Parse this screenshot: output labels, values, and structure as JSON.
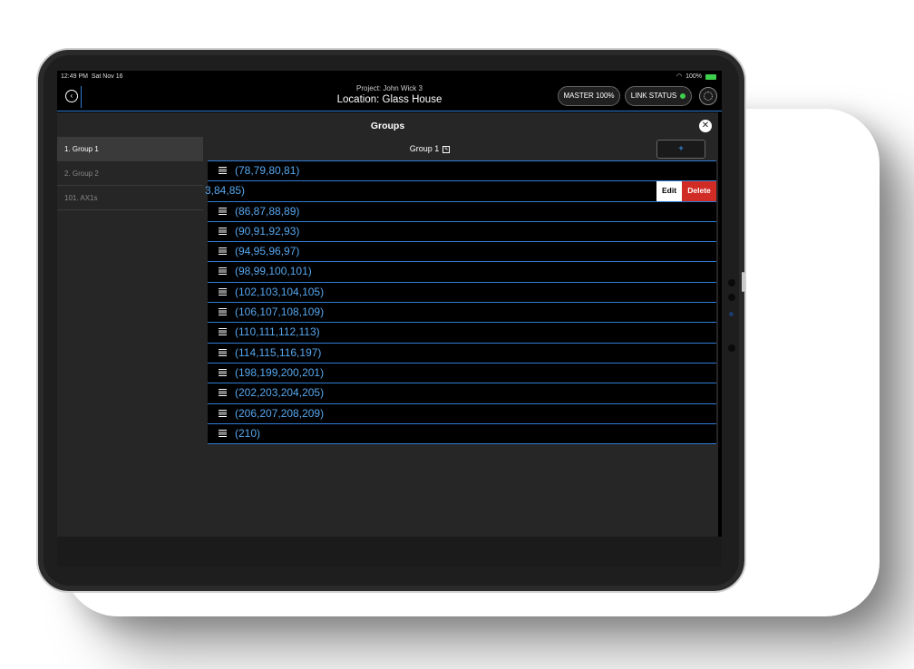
{
  "status_bar": {
    "time": "12:49 PM",
    "date": "Sat Nov 16",
    "battery": "100%"
  },
  "header": {
    "project": "Project: John Wick 3",
    "location": "Location: Glass House",
    "master_label": "MASTER 100%",
    "link_label": "LINK STATUS",
    "link_color": "#3ecf4e"
  },
  "panel": {
    "title": "Groups",
    "close_symbol": "✕",
    "add_symbol": "+",
    "current_group": "Group 1"
  },
  "sidebar": {
    "items": [
      {
        "label": "1. Group 1"
      },
      {
        "label": "2. Group 2"
      },
      {
        "label": "101. AX1s"
      }
    ]
  },
  "rows": [
    {
      "label": "(78,79,80,81)"
    },
    {
      "label": "3,84,85)"
    },
    {
      "label": "(86,87,88,89)"
    },
    {
      "label": "(90,91,92,93)"
    },
    {
      "label": "(94,95,96,97)"
    },
    {
      "label": "(98,99,100,101)"
    },
    {
      "label": "(102,103,104,105)"
    },
    {
      "label": "(106,107,108,109)"
    },
    {
      "label": "(110,111,112,113)"
    },
    {
      "label": "(114,115,116,197)"
    },
    {
      "label": "(198,199,200,201)"
    },
    {
      "label": "(202,203,204,205)"
    },
    {
      "label": "(206,207,208,209)"
    },
    {
      "label": "(210)"
    }
  ],
  "swipe_actions": {
    "edit": "Edit",
    "delete": "Delete"
  },
  "colors": {
    "accent": "#2f7dd6",
    "row_text": "#56a7ef",
    "delete": "#d12b25"
  }
}
